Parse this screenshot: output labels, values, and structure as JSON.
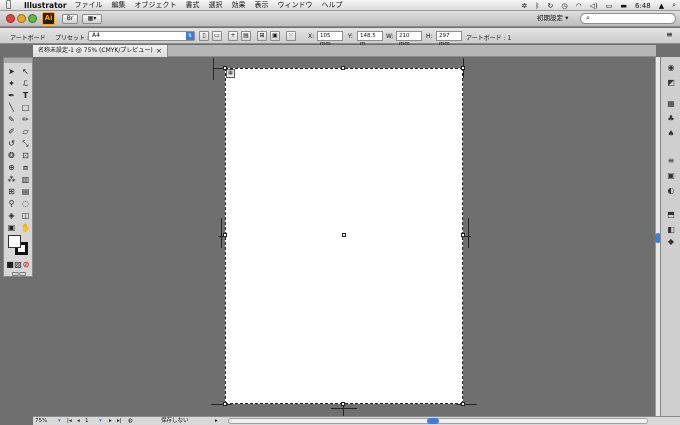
{
  "menubar": {
    "app_name": "Illustrator",
    "menus": [
      "ファイル",
      "編集",
      "オブジェクト",
      "書式",
      "選択",
      "効果",
      "表示",
      "ウィンドウ",
      "ヘルプ"
    ],
    "clock": "6:48"
  },
  "appbar": {
    "logo": "Ai",
    "workspace": "初期設定 ▾"
  },
  "controlbar": {
    "artboard_label": "アートボード",
    "preset_label": "プリセット :",
    "preset_value": "A4",
    "x_label": "X:",
    "x_value": "105 mm",
    "y_label": "Y:",
    "y_value": "148.5 m",
    "w_label": "W:",
    "w_value": "210 mm",
    "h_label": "H:",
    "h_value": "297 mm",
    "artboard_count": "アートボード : 1"
  },
  "document": {
    "tab_title": "名称未設定-1 @ 75% (CMYK/プレビュー)",
    "close": "×"
  },
  "statusbar": {
    "zoom": "75%",
    "page": "1",
    "save_status": "保存しない"
  },
  "colors": {
    "accent_blue": "#3c7bd8",
    "canvas_gray": "#6f6f6f",
    "ai_orange": "#f7a51f"
  }
}
